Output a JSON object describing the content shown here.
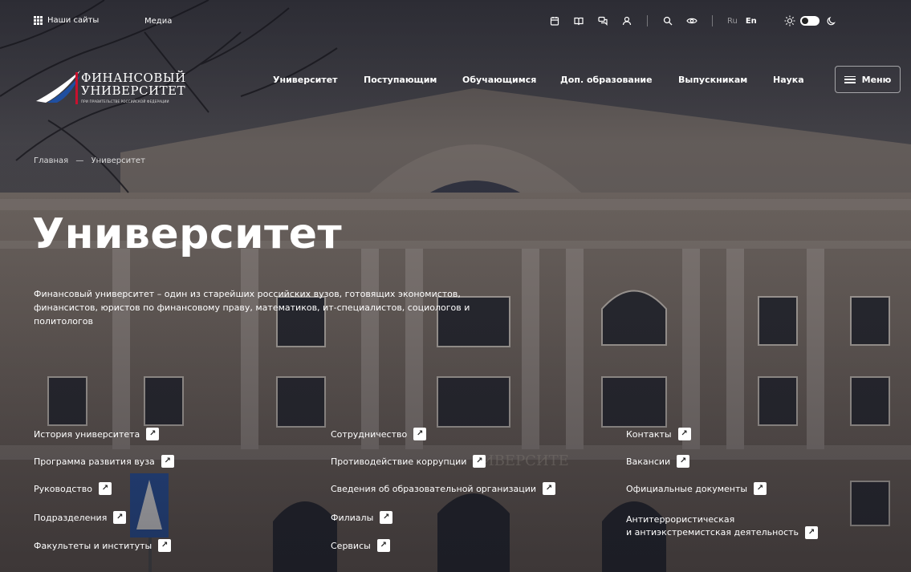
{
  "topbar": {
    "our_sites": "Наши сайты",
    "media": "Медиа",
    "icons": [
      "calendar-icon",
      "book-icon",
      "chat-icon",
      "user-icon",
      "search-icon",
      "eye-icon"
    ],
    "lang_ru": "Ru",
    "lang_en": "En"
  },
  "logo": {
    "line1": "ФИНАНСОВЫЙ",
    "line2": "УНИВЕРСИТЕТ",
    "sub": "ПРИ ПРАВИТЕЛЬСТВЕ РОССИЙСКОЙ ФЕДЕРАЦИИ"
  },
  "nav": {
    "items": [
      "Университет",
      "Поступающим",
      "Обучающимся",
      "Доп. образование",
      "Выпускникам",
      "Наука"
    ],
    "menu": "Меню"
  },
  "breadcrumb": {
    "home": "Главная",
    "sep": "—",
    "current": "Университет"
  },
  "hero": {
    "title": "Университет",
    "description": "Финансовый университет – один из старейших российских вузов, готовящих экономистов, финансистов, юристов по финансовому праву, математиков, ит-специалистов, социологов и политологов"
  },
  "links": {
    "col1": [
      "История университета",
      "Программа развития вуза",
      "Руководство",
      "Подразделения",
      "Факультеты и институты"
    ],
    "col2": [
      "Сотрудничество",
      "Противодействие коррупции",
      "Сведения об образовательной организации",
      "Филиалы",
      "Сервисы"
    ],
    "col3": [
      "Контакты",
      "Вакансии",
      "Официальные документы"
    ],
    "col3_multi_line1": "Антитеррористическая",
    "col3_multi_line2": "и антиэкстремистская деятельность"
  },
  "colors": {
    "accent_red": "#c8102e",
    "accent_blue": "#1f4fa0"
  }
}
